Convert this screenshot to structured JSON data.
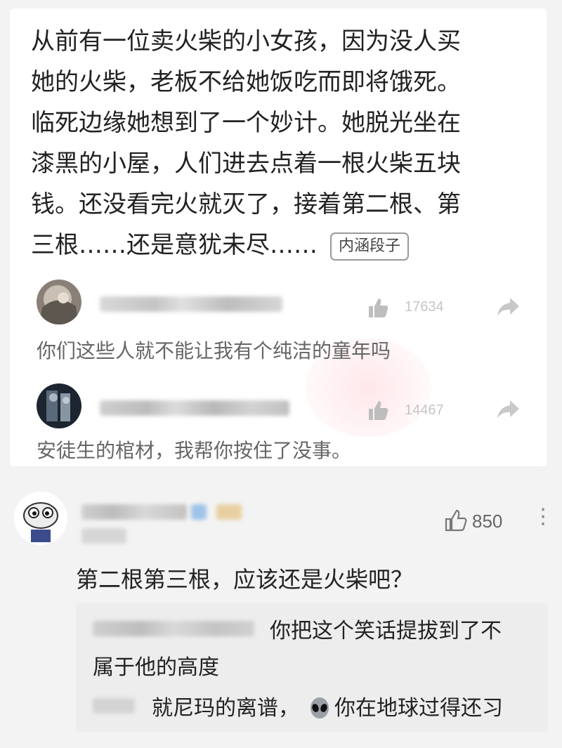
{
  "story": {
    "lines": [
      "从前有一位卖火柴的小女孩，因为没人买",
      "她的火柴，老板不给她饭吃而即将饿死。",
      "临死边缘她想到了一个妙计。她脱光坐在",
      "漆黑的小屋，人们进去点着一根火柴五块",
      "钱。还没看完火就灭了，接着第二根、第",
      "三根……还是意犹未尽……"
    ],
    "tag": "内涵段子"
  },
  "comments": [
    {
      "likes": "17634",
      "text": "你们这些人就不能让我有个纯洁的童年吗"
    },
    {
      "likes": "14467",
      "text": "安徒生的棺材，我帮你按住了没事。"
    }
  ],
  "reply": {
    "likes": "850",
    "more": "⋮",
    "text": "第二根第三根，应该还是火柴吧？",
    "sub_replies": [
      {
        "line1": "你把这个笑话提拔到了不",
        "line2": "属于他的高度"
      },
      {
        "line1": "就尼玛的离谱，",
        "line2": "你在地球过得还习"
      }
    ]
  },
  "colors": {
    "page_bg": "#f3f3f3",
    "card_bg": "#ffffff",
    "sub_bg": "#ededed",
    "muted": "#c6c6c6"
  },
  "icons": [
    "thumbs-up-icon",
    "share-icon",
    "more-icon",
    "alien-emoji-icon"
  ]
}
